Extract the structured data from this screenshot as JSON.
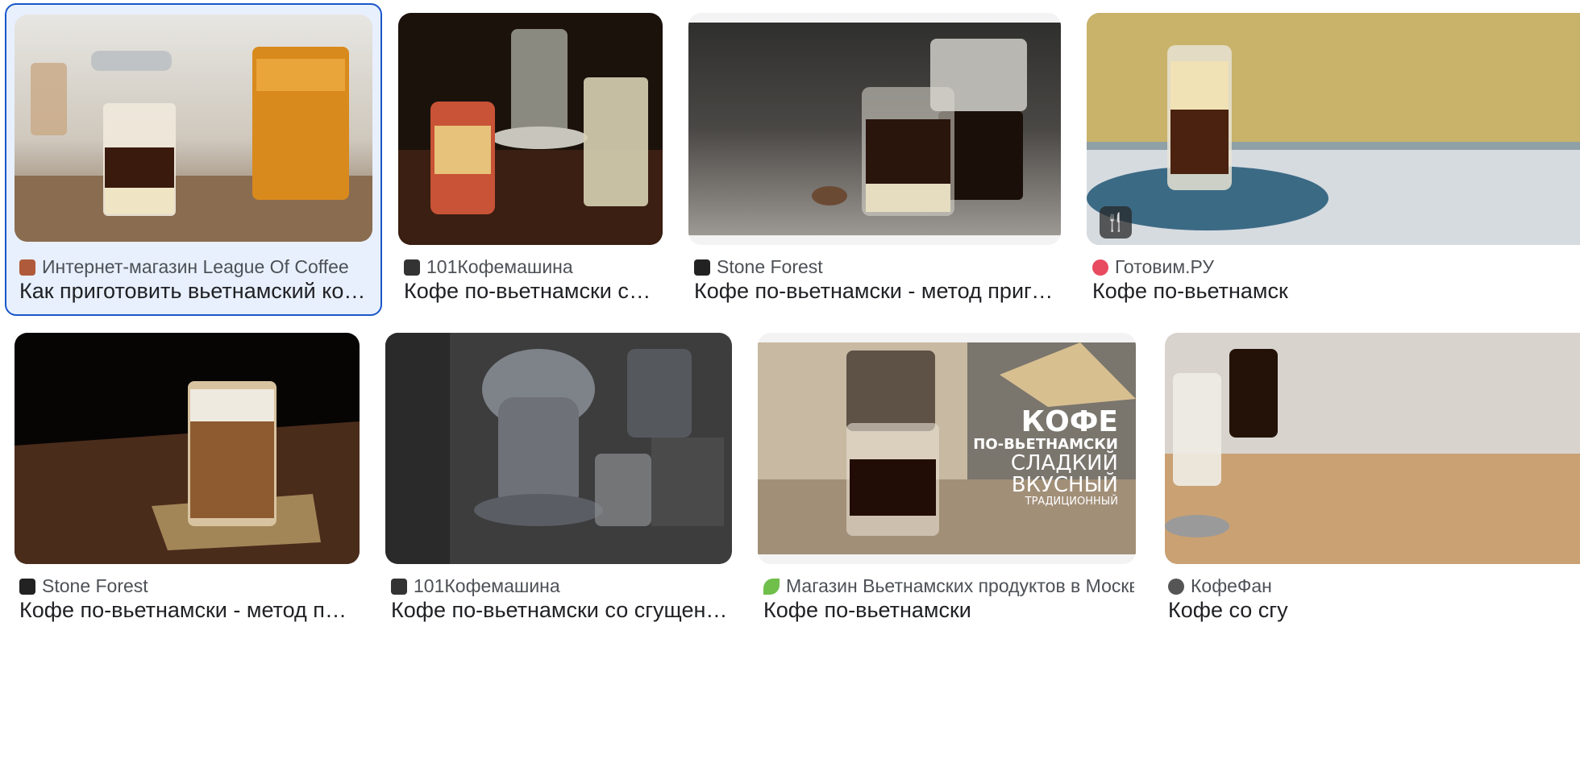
{
  "results": [
    {
      "source": "Интернет-магазин League Of Coffee",
      "title": "Как приготовить вьетнамский кофе? …",
      "favicon": "house-icon",
      "favicon_color": "#b05a3c",
      "selected": true,
      "image": "vietnamese-phin-coffee-with-chicory-can"
    },
    {
      "source": "101Кофемашина",
      "title": "Кофе по-вьетнамски со сг…",
      "favicon": "coffee-machine-icon",
      "favicon_color": "#333333",
      "image": "phin-filter-with-condensed-milk-can"
    },
    {
      "source": "Stone Forest",
      "title": "Кофе по-вьетнамски - метод приготов…",
      "favicon": "hammer-pick-icon",
      "favicon_color": "#222222",
      "image": "glass-mug-with-phin-filter"
    },
    {
      "source": "Готовим.РУ",
      "title": "Кофе по-вьетнамск",
      "favicon": "gotovim-logo-icon",
      "favicon_color": "#e84a5f",
      "badge": "recipe-icon",
      "image": "egg-coffee-glass"
    },
    {
      "source": "Stone Forest",
      "title": "Кофе по-вьетнамски - метод приго…",
      "favicon": "hammer-pick-icon",
      "favicon_color": "#222222",
      "image": "iced-coffee-glass-on-wood"
    },
    {
      "source": "101Кофемашина",
      "title": "Кофе по-вьетнамски со сгущенкой: …",
      "favicon": "coffee-machine-icon",
      "favicon_color": "#333333",
      "image": "trung-nguyen-phin-filters"
    },
    {
      "source": "Магазин Вьетнамских продуктов в Москве",
      "title": "Кофе по-вьетнамски",
      "favicon": "leaf-icon",
      "favicon_color": "#6fbf4a",
      "image": "coffee-banner",
      "overlay": [
        "КОФЕ",
        "ПО-ВЬЕТНАМСКИ",
        "СЛАДКИЙ",
        "ВКУСНЫЙ",
        "ТРАДИЦИОННЫЙ"
      ]
    },
    {
      "source": "КофеФан",
      "title": "Кофе со сгу",
      "favicon": "kofefan-logo-icon",
      "favicon_color": "#555555",
      "image": "coffee-glasses-with-spoon"
    }
  ],
  "accent_color": "#1a56c8"
}
